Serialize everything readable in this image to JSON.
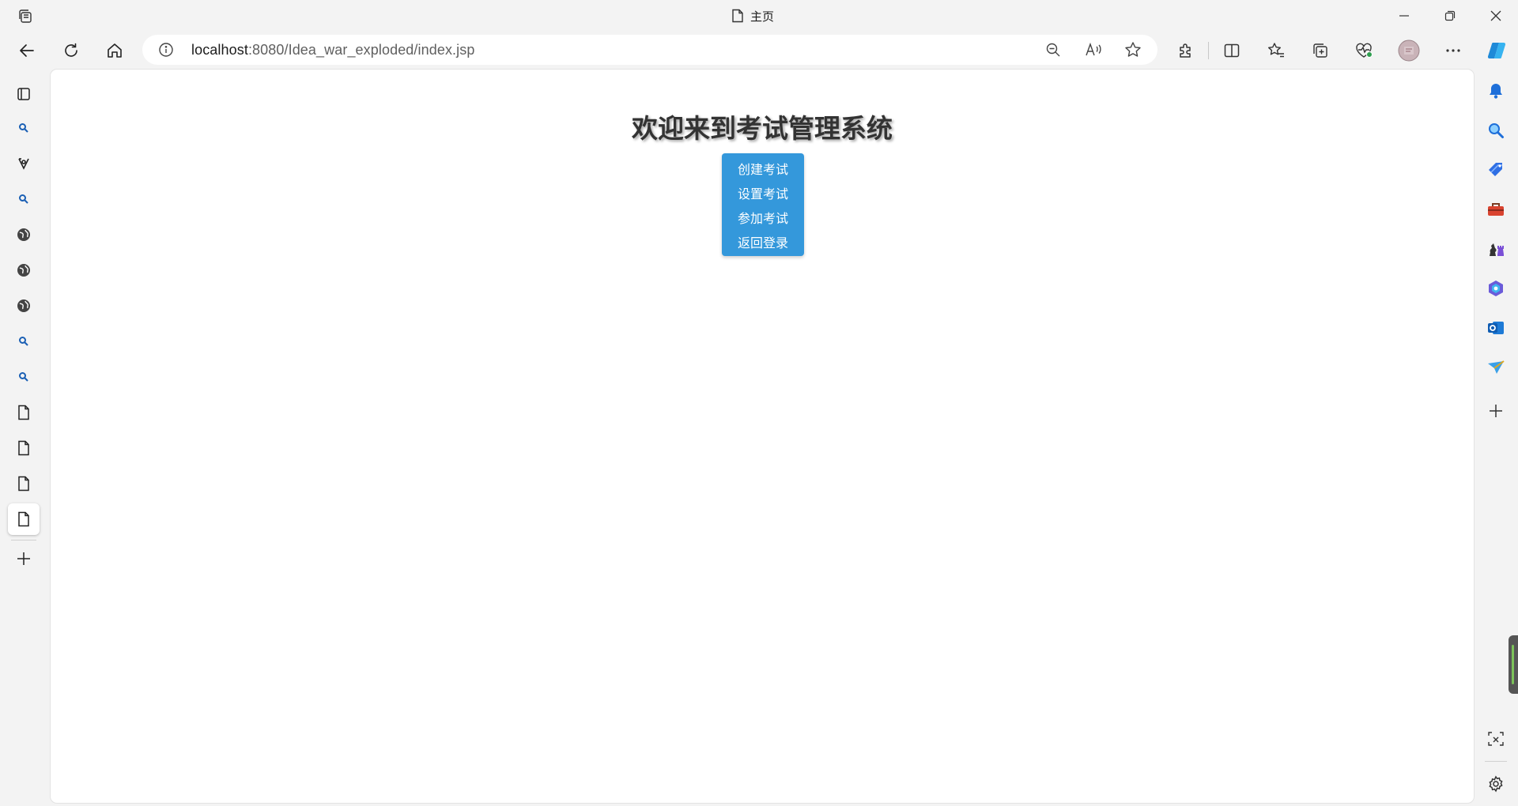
{
  "window": {
    "tab_title": "主页"
  },
  "address_bar": {
    "url_host": "localhost",
    "url_rest": ":8080/Idea_war_exploded/index.jsp"
  },
  "page": {
    "heading": "欢迎来到考试管理系统",
    "menu": [
      {
        "label": "创建考试"
      },
      {
        "label": "设置考试"
      },
      {
        "label": "参加考试"
      },
      {
        "label": "返回登录"
      }
    ]
  },
  "colors": {
    "menu_background": "#3498db",
    "heading_text": "#333333",
    "browser_chrome": "#f3f3f3"
  },
  "icons": {
    "vertical_tabs": [
      "search-icon",
      "reading-icon",
      "search-icon",
      "globe-icon",
      "globe-icon",
      "globe-icon",
      "search-icon",
      "search-icon",
      "document-icon",
      "document-icon",
      "document-icon",
      "document-icon"
    ],
    "right_sidebar": [
      "bell-icon",
      "search-icon",
      "tag-icon",
      "toolbox-icon",
      "chess-icon",
      "copilot-icon",
      "outlook-icon",
      "send-icon",
      "add-icon"
    ]
  }
}
